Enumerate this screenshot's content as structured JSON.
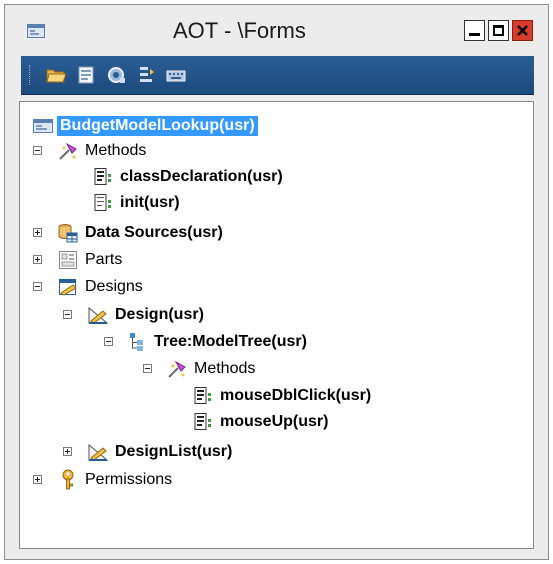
{
  "window": {
    "title": "AOT - \\Forms"
  },
  "toolbar": {
    "buttons": [
      "open-icon",
      "properties-icon",
      "compile-icon",
      "import-icon",
      "keyboard-icon"
    ]
  },
  "tree": {
    "root": "BudgetModelLookup(usr)",
    "methods": "Methods",
    "class_declaration": "classDeclaration(usr)",
    "init": "init(usr)",
    "data_sources": "Data Sources(usr)",
    "parts": "Parts",
    "designs": "Designs",
    "design": "Design(usr)",
    "tree_control": "Tree:ModelTree(usr)",
    "tree_methods": "Methods",
    "mouse_dbl_click": "mouseDblClick(usr)",
    "mouse_up": "mouseUp(usr)",
    "design_list": "DesignList(usr)",
    "permissions": "Permissions"
  },
  "colors": {
    "selection": "#3399ff",
    "toolbar": "#1e4a7d",
    "close_button": "#d83b2b"
  }
}
